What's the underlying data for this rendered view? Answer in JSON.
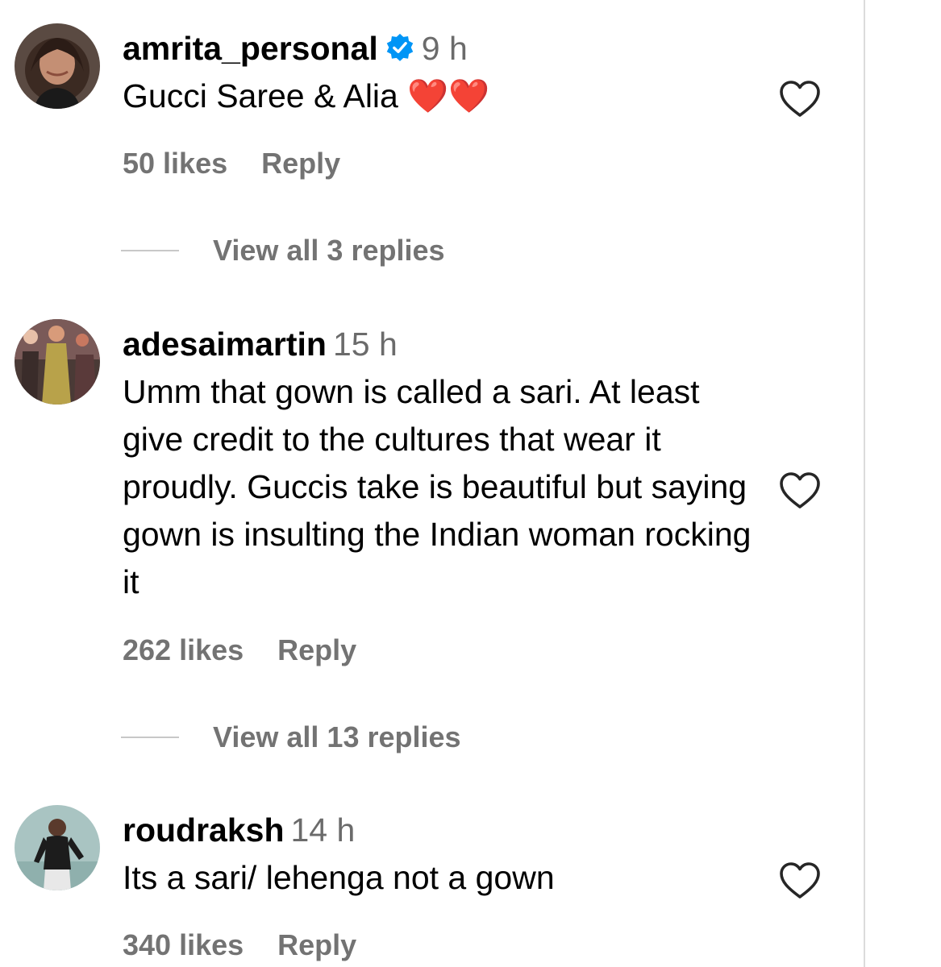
{
  "comments": [
    {
      "username": "amrita_personal",
      "verified": true,
      "time": "9 h",
      "text": "Gucci Saree & Alia ❤️❤️",
      "likes": "50 likes",
      "reply_label": "Reply",
      "view_replies": "View all 3 replies"
    },
    {
      "username": "adesaimartin",
      "verified": false,
      "time": "15 h",
      "text": "Umm that gown is called a sari. At least give credit to the cultures that wear it proudly. Guccis take is beautiful but saying gown is insulting the Indian woman rocking it",
      "likes": "262 likes",
      "reply_label": "Reply",
      "view_replies": "View all 13 replies"
    },
    {
      "username": "roudraksh",
      "verified": false,
      "time": "14 h",
      "text": "Its a sari/ lehenga not a gown",
      "likes": "340 likes",
      "reply_label": "Reply"
    }
  ],
  "colors": {
    "secondary_text": "#737373",
    "verified_badge": "#0095f6",
    "divider": "#dbdbdb"
  },
  "icons": {
    "like": "heart-outline-icon",
    "verified": "verified-badge-icon"
  }
}
